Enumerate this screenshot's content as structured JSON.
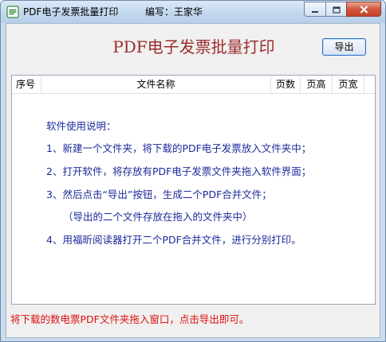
{
  "window": {
    "title": "PDF电子发票批量打印",
    "author": "编写：王家华"
  },
  "main": {
    "heading": "PDF电子发票批量打印",
    "export_label": "导出"
  },
  "table": {
    "columns": [
      "序号",
      "文件名称",
      "页数",
      "页高",
      "页宽"
    ]
  },
  "instructions": {
    "title": "软件使用说明：",
    "lines": [
      "1、新建一个文件夹，将下载的PDF电子发票放入文件夹中；",
      "2、打开软件，将存放有PDF电子发票文件夹拖入软件界面；",
      "3、然后点击“导出”按钮，生成二个PDF合并文件；",
      "（导出的二个文件存放在拖入的文件夹中）",
      "4、用福昕阅读器打开二个PDF合并文件，进行分别打印。"
    ]
  },
  "status": {
    "text": "将下载的数电票PDF文件夹拖入窗口，点击导出即可。"
  },
  "colors": {
    "heading": "#9b2b2b",
    "instructions": "#1c2a9a",
    "status": "#e01010",
    "close_button": "#c7442a"
  },
  "icons": {
    "app": "app-icon",
    "minimize": "minimize-icon",
    "maximize": "maximize-icon",
    "close": "close-icon"
  }
}
